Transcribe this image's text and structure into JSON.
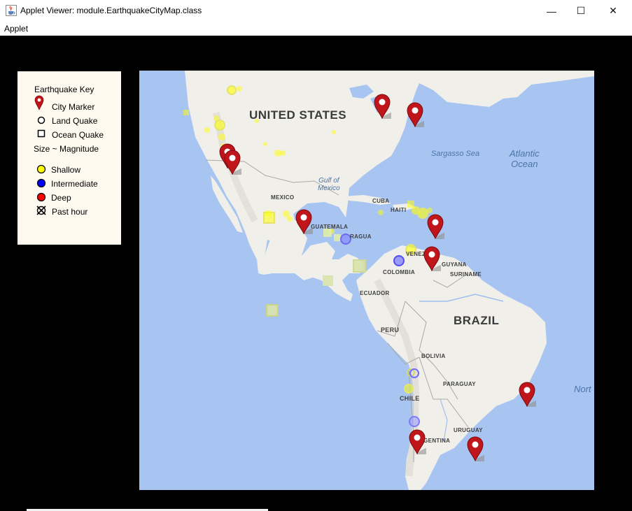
{
  "window": {
    "title": "Applet Viewer: module.EarthquakeCityMap.class",
    "minimize_glyph": "—",
    "maximize_glyph": "☐",
    "close_glyph": "✕",
    "app_icon": "java-cup-icon"
  },
  "menubar": {
    "applet_label": "Applet"
  },
  "legend": {
    "title": "Earthquake Key",
    "city_marker": "City Marker",
    "land_quake": "Land Quake",
    "ocean_quake": "Ocean Quake",
    "size_note": "Size ~ Magnitude",
    "shallow": "Shallow",
    "intermediate": "Intermediate",
    "deep": "Deep",
    "past_hour": "Past hour",
    "colors": {
      "shallow": "#ffff00",
      "intermediate": "#0000ff",
      "deep": "#ff0000",
      "city": "#c0161b",
      "background": "#fffaf0"
    }
  },
  "map": {
    "labels": {
      "united_states": "UNITED STATES",
      "mexico": "MEXICO",
      "cuba": "CUBA",
      "haiti": "HAITI",
      "guatemala": "GUATEMALA",
      "nicaragua": "RAGUA",
      "venezuela": "VENEZUE",
      "guyana": "GUYANA",
      "suriname": "SURINAME",
      "colombia": "COLOMBIA",
      "ecuador": "ECUADOR",
      "peru": "PERU",
      "brazil": "BRAZIL",
      "bolivia": "BOLIVIA",
      "paraguay": "PARAGUAY",
      "chile": "CHILE",
      "uruguay": "URUGUAY",
      "argentina": "ARGENTINA",
      "gulf_of_mexico": "Gulf of\nMexico",
      "sargasso": "Sargasso Sea",
      "atlantic": "Atlantic\nOcean",
      "north": "Nort"
    },
    "colors": {
      "ocean": "#a8c5f2",
      "land": "#f1efea",
      "shadow": "#8f8f8f"
    }
  }
}
